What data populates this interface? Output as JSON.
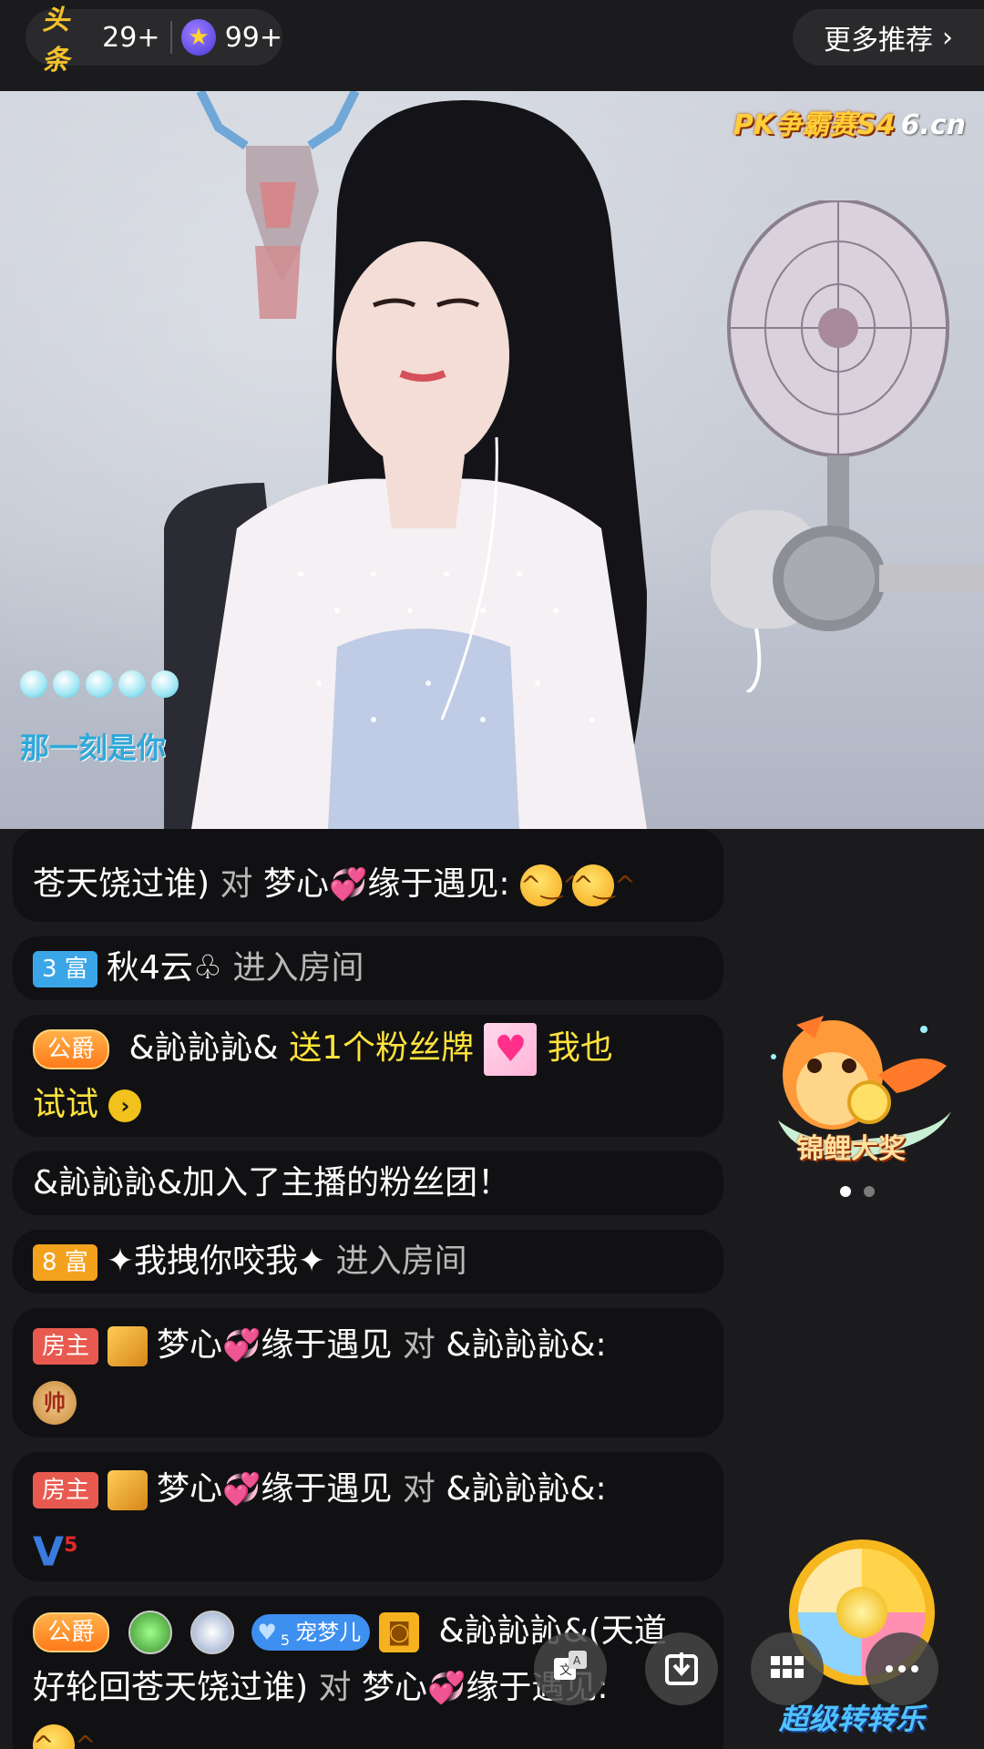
{
  "top_bar": {
    "toutiao_logo": "头条",
    "toutiao_count": "29+",
    "star_count": "99+",
    "more_recommend": "更多推荐"
  },
  "video": {
    "watermark": "PK争霸赛S4",
    "watermark_site": "6.cn",
    "overlay_text": "那一刻是你"
  },
  "chat": {
    "m1": {
      "user": "苍天饶过谁)",
      "verb": "对",
      "target": "梦心",
      "target2": "缘于遇见:"
    },
    "m2": {
      "badge": "3 富",
      "user": "秋4云",
      "action": "进入房间"
    },
    "m3": {
      "badge": "公爵",
      "user": "&訫訫訫&",
      "action": "送1个粉丝牌",
      "extra": "我也",
      "extra2": "试试"
    },
    "m4": {
      "text": "&訫訫訫&加入了主播的粉丝团！"
    },
    "m5": {
      "badge": "8 富",
      "user": "✦我拽你咬我✦",
      "action": "进入房间"
    },
    "m6": {
      "badge": "房主",
      "user": "梦心",
      "user2": "缘于遇见",
      "verb": "对",
      "target": "&訫訫訫&:",
      "chess": "帅"
    },
    "m7": {
      "badge": "房主",
      "user": "梦心",
      "user2": "缘于遇见",
      "verb": "对",
      "target": "&訫訫訫&:",
      "level": "5"
    },
    "m8": {
      "badge": "公爵",
      "pet_level": "5",
      "pet_name": "宠梦儿",
      "user": "&訫訫訫&(天道",
      "user_cont": "好轮回苍天饶过谁)",
      "verb": "对",
      "target": "梦心",
      "target2": "缘于遇见:"
    }
  },
  "side": {
    "koi_label": "锦鲤大奖",
    "wheel_label": "超级转转乐"
  },
  "colors": {
    "background": "#1b1b1d",
    "chat_bubble": "#111113",
    "highlight_yellow": "#ffe33c"
  }
}
